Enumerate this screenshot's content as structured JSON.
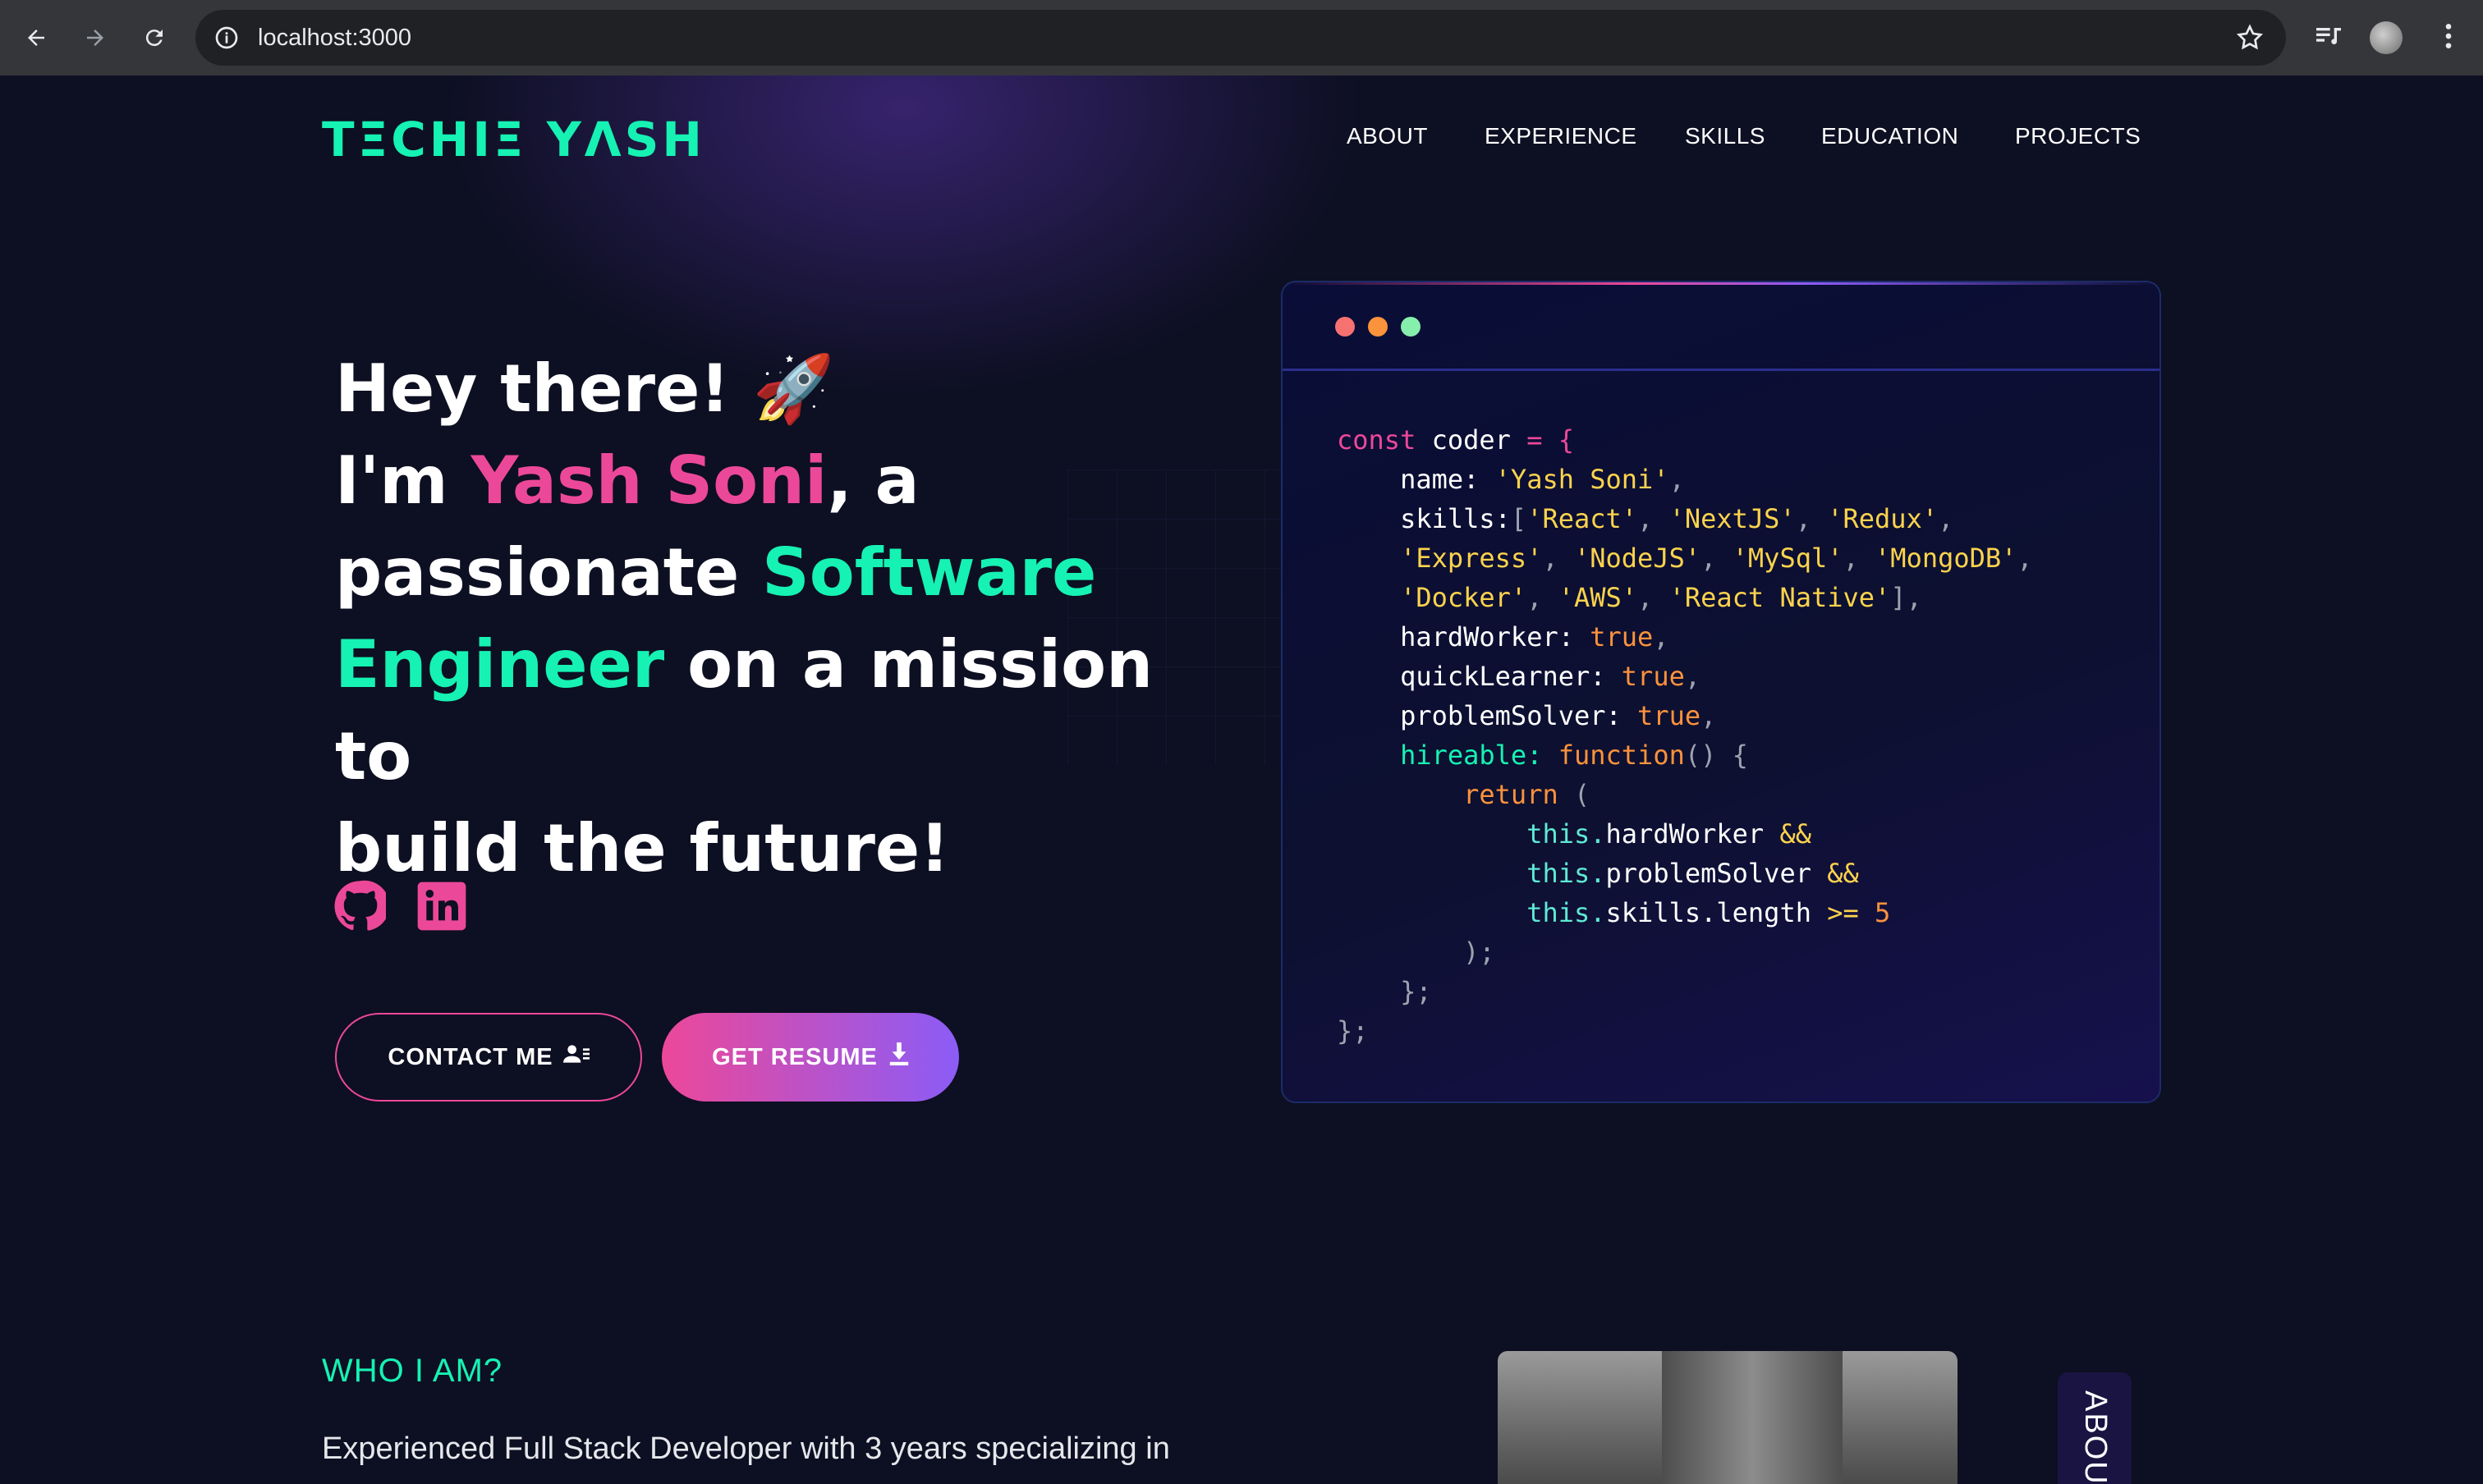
{
  "browser": {
    "url": "localhost:3000"
  },
  "header": {
    "logo": "TΞCHIΞ YΛSH",
    "nav": [
      "ABOUT",
      "EXPERIENCE",
      "SKILLS",
      "EDUCATION",
      "PROJECTS"
    ]
  },
  "hero": {
    "line1": "Hey there! ",
    "rocket": "🚀",
    "im": "I'm ",
    "name": "Yash Soni",
    "after_name": ", a",
    "passionate": "passionate ",
    "role1": "Software",
    "role2": "Engineer",
    "mission": " on a mission to",
    "future": "build the future!"
  },
  "buttons": {
    "contact": "CONTACT ME",
    "resume": "GET RESUME"
  },
  "code": {
    "window_dot_colors": [
      "#f87171",
      "#fb923c",
      "#86efac"
    ],
    "const": "const",
    "var": " coder ",
    "eq_open": "= {",
    "name_key": "name: ",
    "name_val": "'Yash Soni'",
    "skills_key": "skills:",
    "skills": [
      "'React'",
      "'NextJS'",
      "'Redux'",
      "'Express'",
      "'NodeJS'",
      "'MySql'",
      "'MongoDB'",
      "'Docker'",
      "'AWS'",
      "'React Native'"
    ],
    "hardWorker": "hardWorker: ",
    "quickLearner": "quickLearner: ",
    "problemSolver": "problemSolver: ",
    "true_val": "true",
    "hireable": "hireable: ",
    "function": "function",
    "return": "return",
    "this": "this.",
    "hw": "hardWorker",
    "ps": "problemSolver",
    "sl": "skills.length",
    "and": "&&",
    "gte": ">=",
    "five": "5"
  },
  "about": {
    "heading": "WHO I AM?",
    "text": "Experienced Full Stack Developer with 3 years specializing in",
    "side_tab": "ABOUT"
  },
  "colors": {
    "accent_green": "#16f2b3",
    "accent_pink": "#ec4899",
    "accent_purple": "#8b5cf6",
    "background": "#0d0f22"
  },
  "icons": [
    "back-arrow-icon",
    "forward-arrow-icon",
    "reload-icon",
    "info-icon",
    "star-icon",
    "media-icon",
    "menu-dots-icon",
    "github-icon",
    "linkedin-icon",
    "contact-card-icon",
    "download-icon"
  ]
}
